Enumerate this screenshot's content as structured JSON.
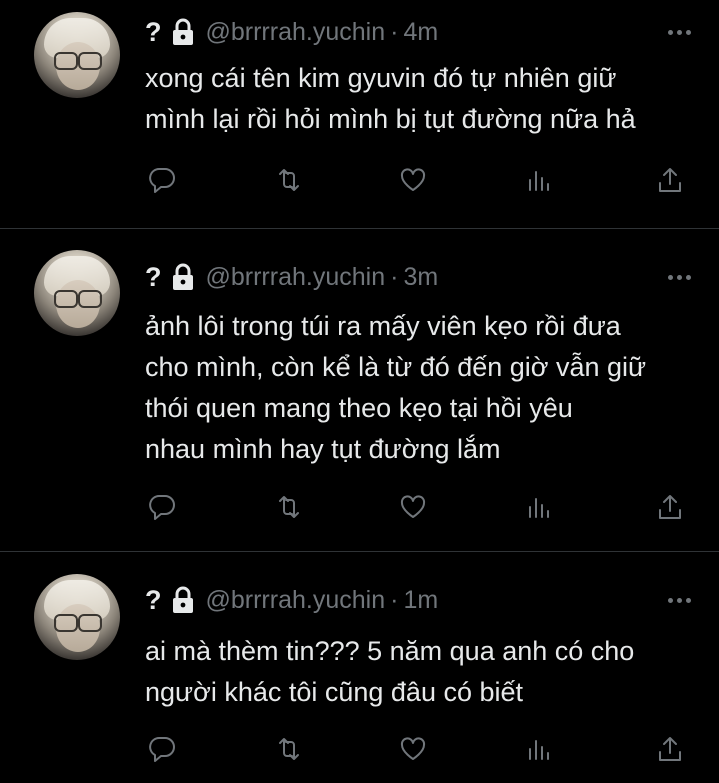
{
  "tweets": [
    {
      "name_glyph": "?",
      "handle": "@brrrrah.yuchin",
      "separator": "·",
      "time": "4m",
      "lines": [
        "xong cái tên kim gyuvin đó tự nhiên giữ",
        "mình lại rồi hỏi mình bị tụt đường nữa hả"
      ]
    },
    {
      "name_glyph": "?",
      "handle": "@brrrrah.yuchin",
      "separator": "·",
      "time": "3m",
      "lines": [
        "ảnh lôi trong túi ra mấy viên kẹo rồi đưa",
        "cho mình, còn kể là từ đó đến giờ vẫn giữ",
        "thói quen mang theo kẹo tại hồi yêu",
        "nhau mình hay tụt đường lắm"
      ]
    },
    {
      "name_glyph": "?",
      "handle": "@brrrrah.yuchin",
      "separator": "·",
      "time": "1m",
      "lines": [
        "ai mà thèm tin??? 5 năm qua anh có cho",
        "người khác tôi cũng đâu có biết"
      ]
    }
  ],
  "icons": {
    "lock": "lock-icon",
    "more": "more-dots-icon",
    "reply": "reply-icon",
    "retweet": "retweet-icon",
    "like": "like-icon",
    "views": "views-icon",
    "share": "share-icon"
  },
  "colors": {
    "background": "#000000",
    "text": "#e7e9ea",
    "muted": "#71767b",
    "divider": "#2f3336"
  }
}
